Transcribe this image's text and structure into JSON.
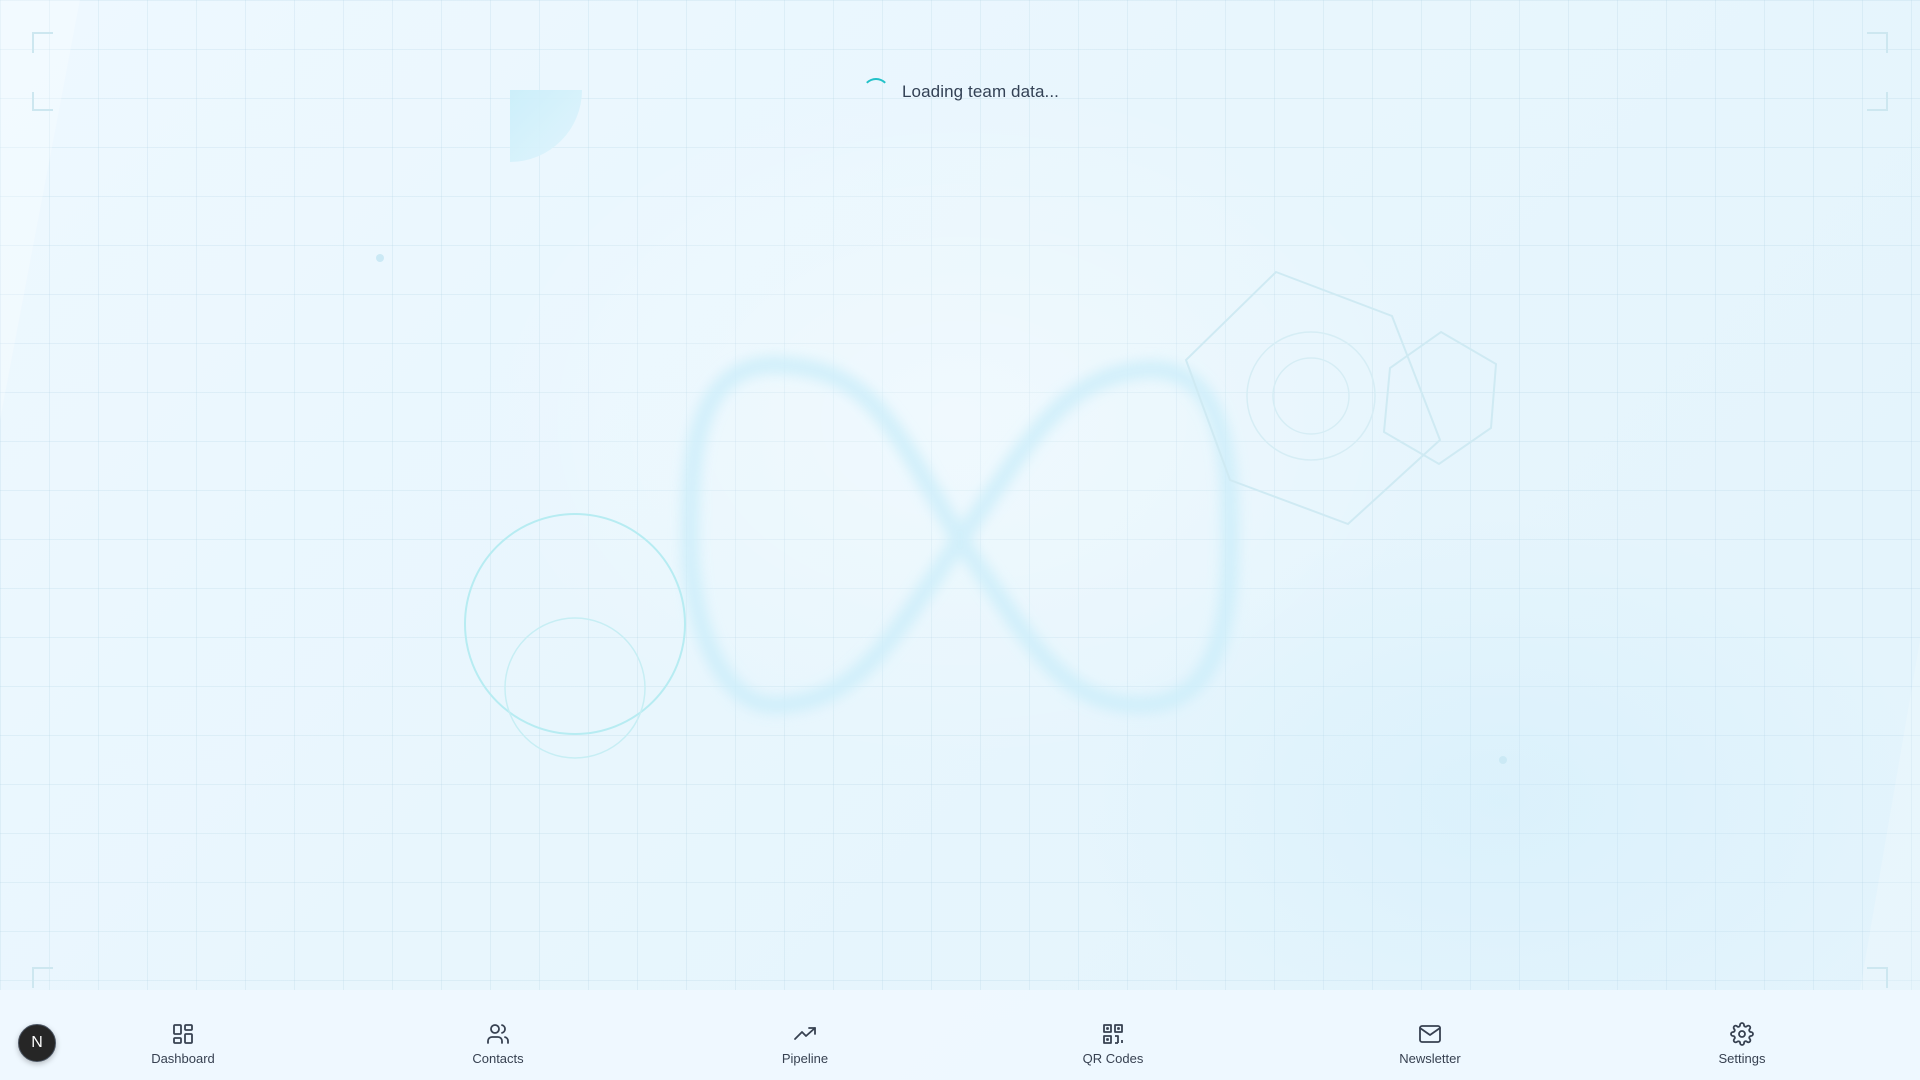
{
  "loading": {
    "message": "Loading team data..."
  },
  "bottom_nav": {
    "items": [
      {
        "label": "Dashboard",
        "icon": "grid-icon"
      },
      {
        "label": "Contacts",
        "icon": "users-icon"
      },
      {
        "label": "Pipeline",
        "icon": "trending-up-icon"
      },
      {
        "label": "QR Codes",
        "icon": "qr-code-icon"
      },
      {
        "label": "Newsletter",
        "icon": "mail-icon"
      },
      {
        "label": "Settings",
        "icon": "gear-icon"
      }
    ]
  },
  "avatar": {
    "letter": "N"
  },
  "colors": {
    "accent": "#22c1c8",
    "text": "#374151",
    "background": "#eaf6fd",
    "avatar_bg": "#262626"
  }
}
